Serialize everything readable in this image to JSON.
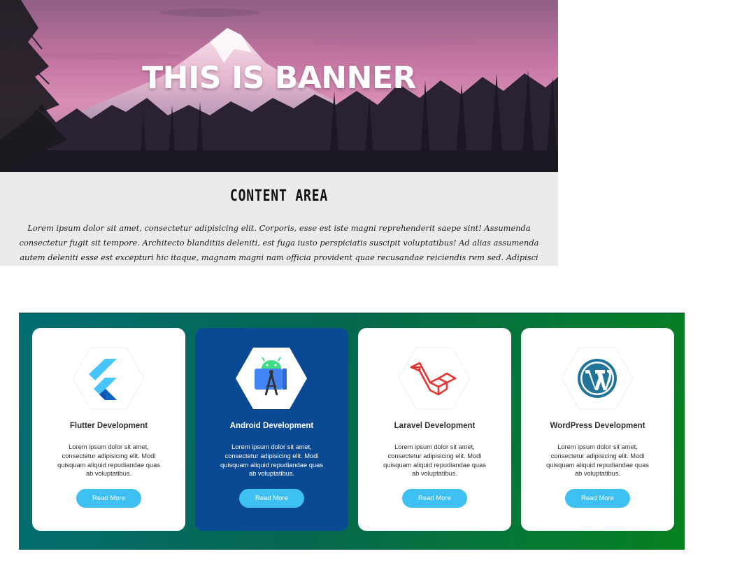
{
  "banner": {
    "title": "THIS IS BANNER"
  },
  "content": {
    "title": "CONTENT AREA",
    "text": "Lorem ipsum dolor sit amet, consectetur adipisicing elit. Corporis, esse est iste magni reprehenderit saepe sint! Assumenda consectetur fugit sit tempore. Architecto blanditiis deleniti, est fuga iusto perspiciatis suscipit voluptatibus! Ad alias assumenda autem deleniti esse est excepturi hic itaque, magnam magni nam officia provident quae recusandae reiciendis rem sed. Adipisci animi aut autem deserunt dolore, ea eius error ex"
  },
  "services": {
    "accent": "#3ec0f2",
    "active_bg": "#0a4a95",
    "cards": [
      {
        "icon": "flutter-icon",
        "title": "Flutter Development",
        "text": "Lorem ipsum dolor sit amet, consectetur adipisicing elit. Modi quisquam aliquid repudiandae quas ab voluptatibus.",
        "button": "Read More"
      },
      {
        "icon": "android-studio-icon",
        "title": "Android Development",
        "text": "Lorem ipsum dolor sit amet, consectetur adipisicing elit. Modi quisquam aliquid repudiandae quas ab voluptatibus.",
        "button": "Read More"
      },
      {
        "icon": "laravel-icon",
        "title": "Laravel Development",
        "text": "Lorem ipsum dolor sit amet, consectetur adipisicing elit. Modi quisquam aliquid repudiandae quas ab voluptatibus.",
        "button": "Read More"
      },
      {
        "icon": "wordpress-icon",
        "title": "WordPress Development",
        "text": "Lorem ipsum dolor sit amet, consectetur adipisicing elit. Modi quisquam aliquid repudiandae quas ab voluptatibus.",
        "button": "Read More"
      }
    ]
  }
}
